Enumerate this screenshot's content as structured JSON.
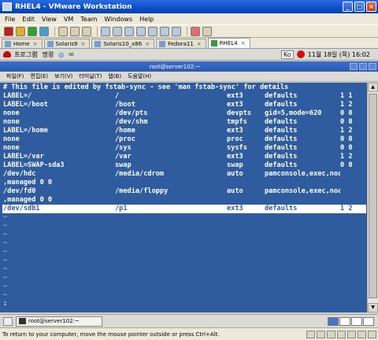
{
  "window": {
    "title": "RHEL4 - VMware Workstation"
  },
  "menubar": [
    "File",
    "Edit",
    "View",
    "VM",
    "Team",
    "Windows",
    "Help"
  ],
  "vm_tabs": [
    {
      "label": "Home",
      "active": false
    },
    {
      "label": "Solaris9",
      "active": false
    },
    {
      "label": "Solaris10_x86",
      "active": false
    },
    {
      "label": "Fedora11",
      "active": false
    },
    {
      "label": "RHEL4",
      "active": true
    }
  ],
  "gnome_panel": {
    "menu1": "프로그램",
    "menu2": "명령",
    "ime": "Ko",
    "clock": "11월 18일 (목) 16:02"
  },
  "terminal_window": {
    "title": "root@server102:~",
    "menu": [
      "파일(F)",
      "편집(E)",
      "보기(V)",
      "터미널(T)",
      "탭(B)",
      "도움말(H)"
    ]
  },
  "terminal": {
    "header": "# This file is edited by fstab-sync - see 'man fstab-sync' for details",
    "rows": [
      {
        "c1": "LABEL=/",
        "c2": "/",
        "c3": "ext3",
        "c4": "defaults",
        "c5": "1 1"
      },
      {
        "c1": "LABEL=/boot",
        "c2": "/boot",
        "c3": "ext3",
        "c4": "defaults",
        "c5": "1 2"
      },
      {
        "c1": "none",
        "c2": "/dev/pts",
        "c3": "devpts",
        "c4": "gid=5,mode=620",
        "c5": "0 0"
      },
      {
        "c1": "none",
        "c2": "/dev/shm",
        "c3": "tmpfs",
        "c4": "defaults",
        "c5": "0 0"
      },
      {
        "c1": "LABEL=/home",
        "c2": "/home",
        "c3": "ext3",
        "c4": "defaults",
        "c5": "1 2"
      },
      {
        "c1": "none",
        "c2": "/proc",
        "c3": "proc",
        "c4": "defaults",
        "c5": "0 0"
      },
      {
        "c1": "none",
        "c2": "/sys",
        "c3": "sysfs",
        "c4": "defaults",
        "c5": "0 0"
      },
      {
        "c1": "LABEL=/var",
        "c2": "/var",
        "c3": "ext3",
        "c4": "defaults",
        "c5": "1 2"
      },
      {
        "c1": "LABEL=SWAP-sda3",
        "c2": "swap",
        "c3": "swap",
        "c4": "defaults",
        "c5": "0 0"
      },
      {
        "c1": "/dev/hdc",
        "c2": "/media/cdrom",
        "c3": "auto",
        "c4": "pamconsole,exec,noauto",
        "c5": ""
      }
    ],
    "wrap1": ",managed 0 0",
    "row_fd0": {
      "c1": "/dev/fd0",
      "c2": "/media/floppy",
      "c3": "auto",
      "c4": "pamconsole,exec,noauto",
      "c5": ""
    },
    "wrap2": ",managed 0 0",
    "highlight_row": {
      "c1": "/dev/sdb1",
      "c2": "/p1",
      "c3": "ext3",
      "c4": "defaults",
      "c5": "1 2"
    },
    "tilde": "~",
    "tilde_count": 10,
    "prompt_line": ":"
  },
  "taskbar": {
    "task_label": "root@server102:~"
  },
  "statusbar": {
    "message": "To return to your computer, move the mouse pointer outside or press Ctrl+Alt."
  },
  "colors": {
    "terminal_bg": "#2f5c9e",
    "terminal_fg": "#ffffff",
    "title_blue": "#0a4ec8"
  }
}
